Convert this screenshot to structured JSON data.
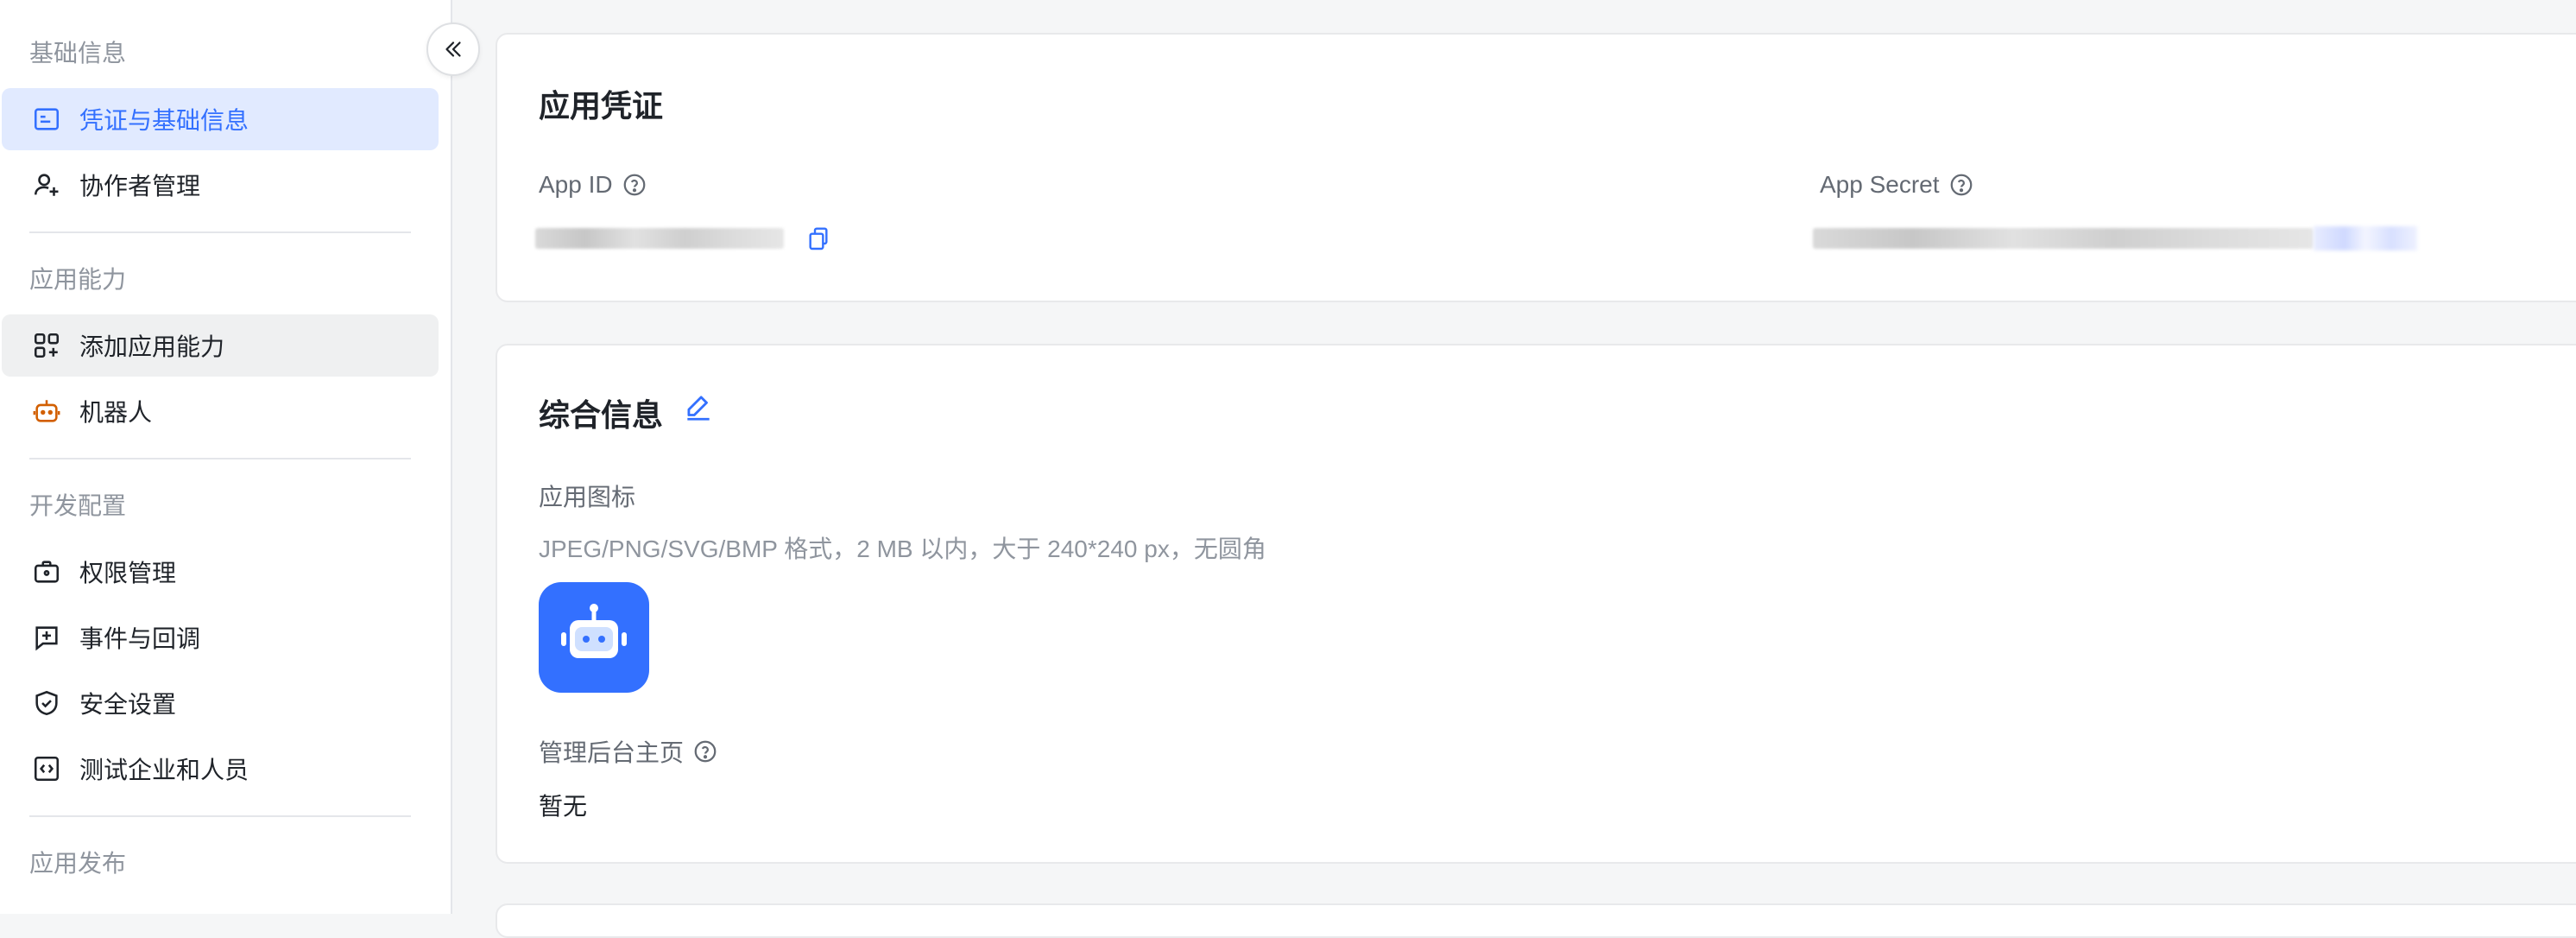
{
  "sidebar": {
    "group_basic": "基础信息",
    "item_credentials": "凭证与基础信息",
    "item_collaborators": "协作者管理",
    "group_abilities": "应用能力",
    "item_add_ability": "添加应用能力",
    "item_bot": "机器人",
    "group_dev": "开发配置",
    "item_permissions": "权限管理",
    "item_events": "事件与回调",
    "item_security": "安全设置",
    "item_test_org": "测试企业和人员",
    "group_release": "应用发布"
  },
  "credentials_card": {
    "title": "应用凭证",
    "app_id_label": "App ID",
    "app_secret_label": "App Secret"
  },
  "info_card": {
    "title": "综合信息",
    "icon_label": "应用图标",
    "icon_hint": "JPEG/PNG/SVG/BMP 格式，2 MB 以内，大于 240*240 px，无圆角",
    "admin_home_label": "管理后台主页",
    "admin_home_value": "暂无"
  },
  "colors": {
    "accent": "#3370ff",
    "active_bg": "#e1eaff",
    "bot_orange": "#d25f00"
  }
}
